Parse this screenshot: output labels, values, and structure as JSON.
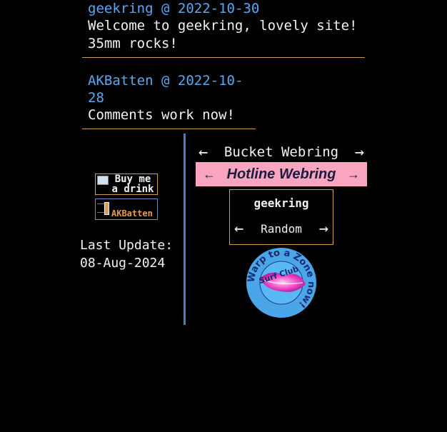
{
  "comments": [
    {
      "author": "geekring",
      "sep": "@",
      "date": "2022-10-30",
      "text": "Welcome to geekring, lovely site!\n35mm rocks!"
    },
    {
      "author": "AKBatten",
      "sep": "@",
      "date": "2022-10-28",
      "text": "Comments work now!"
    }
  ],
  "badges": {
    "drink_line1": "Buy me",
    "drink_line2": "a drink",
    "akbatten": "AKBatten"
  },
  "last_update": {
    "label": "Last Update:",
    "date": "08-Aug-2024"
  },
  "bucket_webring": {
    "prev": "←",
    "title": "Bucket Webring",
    "next": "→"
  },
  "hotline_webring": {
    "prev": "←",
    "title": "Hotline Webring",
    "next": "→"
  },
  "geekring_widget": {
    "name": "geekring",
    "prev": "←",
    "random": "Random",
    "next": "→"
  },
  "surf_club": {
    "ring_text": "Warp to a Zone now!",
    "center_text": "Surf Club"
  },
  "colors": {
    "background": "#000000",
    "link_blue": "#5aa8f0",
    "rule_gold": "#c8a050",
    "divider_blue": "#3f82c9",
    "hotline_pink": "#f9a5c0",
    "hotline_text": "#1a1c40"
  }
}
